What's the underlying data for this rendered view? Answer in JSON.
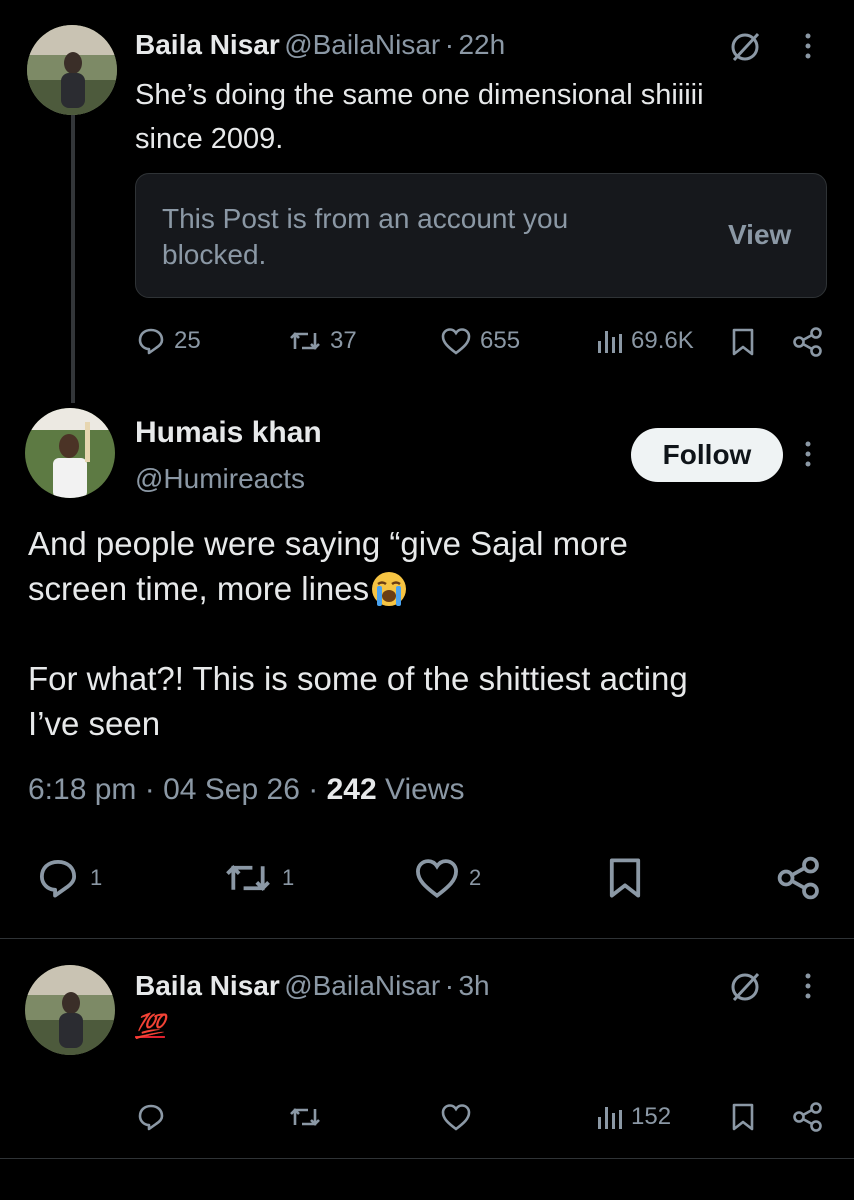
{
  "tweet1": {
    "name": "Baila Nisar",
    "handle": "@BailaNisar",
    "time": "22h",
    "text_line1": "She’s doing the same one dimensional shiiiii",
    "text_line2": "since 2009.",
    "blocked_line1": "This Post is from an account you",
    "blocked_line2": "blocked.",
    "blocked_view": "View",
    "replies": "25",
    "reposts": "37",
    "likes": "655",
    "views": "69.6K"
  },
  "main": {
    "name": "Humais khan",
    "handle": "@Humireacts",
    "follow": "Follow",
    "line1": "And people were saying “give Sajal more",
    "line2": "screen time, more lines",
    "line3": "For what?! This is some of the shittiest acting",
    "line4": "I’ve seen",
    "time": "6:18 pm",
    "date": "04 Sep 26",
    "views_count": "242",
    "views_label": "Views",
    "replies": "1",
    "reposts": "1",
    "likes": "2"
  },
  "tweet3": {
    "name": "Baila Nisar",
    "handle": "@BailaNisar",
    "time": "3h",
    "emoji": "💯",
    "views": "152"
  },
  "colors": {
    "bg": "#000000",
    "text": "#e7e9ea",
    "muted": "#8b98a5",
    "card_bg": "#16181c",
    "border": "#2f3336"
  },
  "icons": [
    "grok-icon",
    "more-vertical-icon",
    "reply-icon",
    "repost-icon",
    "like-icon",
    "views-icon",
    "bookmark-icon",
    "share-icon",
    "crying-emoji",
    "hundred-emoji"
  ]
}
